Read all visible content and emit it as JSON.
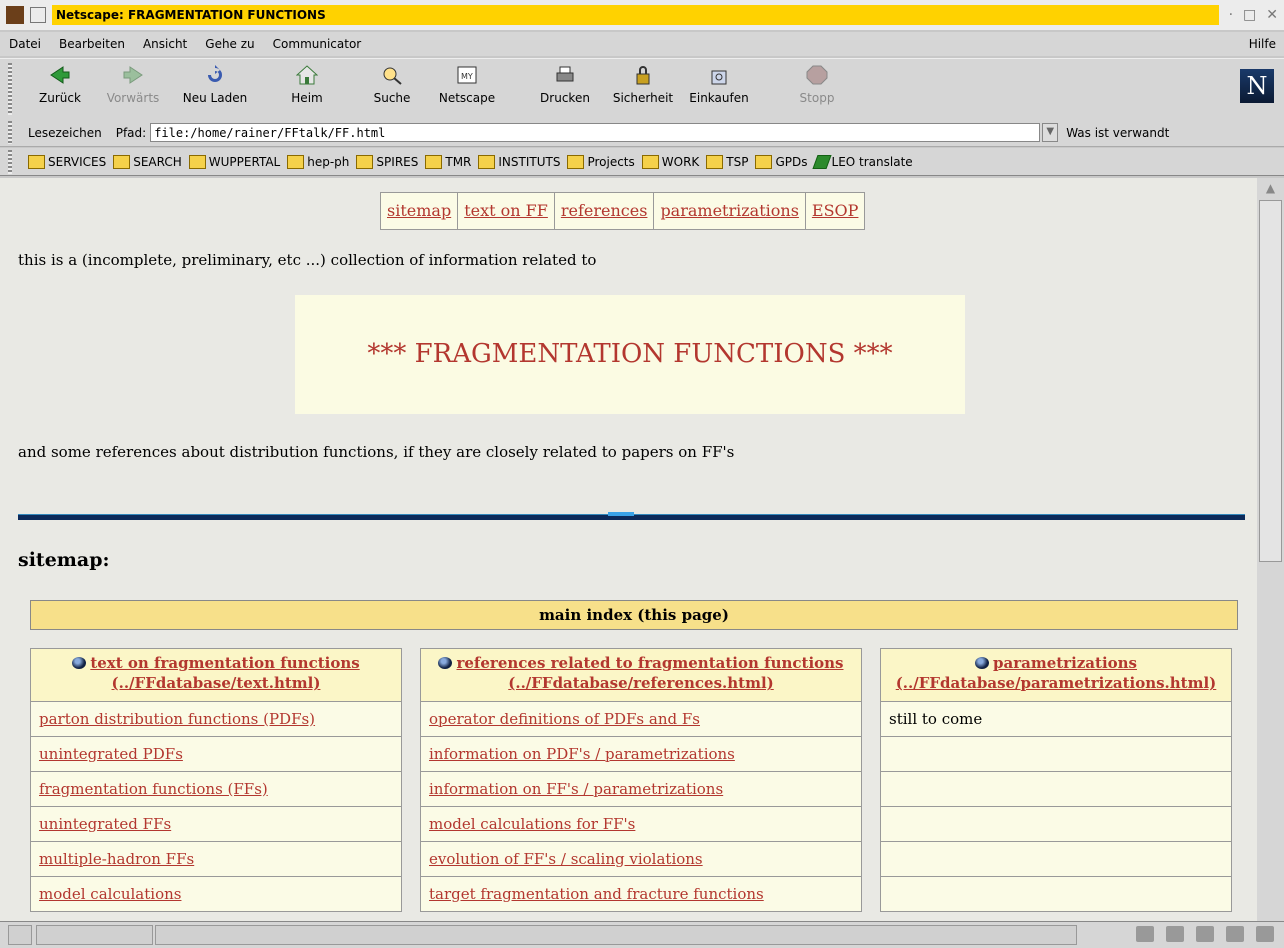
{
  "window": {
    "title": "Netscape: FRAGMENTATION FUNCTIONS",
    "controls": [
      "·",
      "□",
      "✕"
    ]
  },
  "menu": {
    "items": [
      "Datei",
      "Bearbeiten",
      "Ansicht",
      "Gehe zu",
      "Communicator"
    ],
    "help": "Hilfe"
  },
  "toolbar": {
    "back": "Zurück",
    "forward": "Vorwärts",
    "reload": "Neu Laden",
    "home": "Heim",
    "search": "Suche",
    "netscape": "Netscape",
    "print": "Drucken",
    "security": "Sicherheit",
    "shop": "Einkaufen",
    "stop": "Stopp",
    "logo": "N"
  },
  "location": {
    "bookmarks": "Lesezeichen",
    "path_label": "Pfad:",
    "url": "file:/home/rainer/FFtalk/FF.html",
    "related": "Was ist verwandt"
  },
  "bookmarks_bar": [
    "SERVICES",
    "SEARCH",
    "WUPPERTAL",
    "hep-ph",
    "SPIRES",
    "TMR",
    "INSTITUTS",
    "Projects",
    "WORK",
    "TSP",
    "GPDs",
    "LEO translate"
  ],
  "page": {
    "nav": [
      "sitemap",
      "text on FF",
      "references",
      "parametrizations",
      "ESOP"
    ],
    "intro": "this is a (incomplete, preliminary, etc ...) collection of information related to",
    "hero": "*** FRAGMENTATION FUNCTIONS ***",
    "outro": "and some references about distribution functions, if they are closely related to papers on FF's",
    "sitemap_heading": "sitemap:",
    "main_index": "main index (this page)",
    "columns": [
      {
        "title": "text on fragmentation functions",
        "path": "(../FFdatabase/text.html)",
        "rows": [
          "parton distribution functions (PDFs)",
          "unintegrated PDFs",
          "fragmentation functions (FFs)",
          "unintegrated FFs",
          "multiple-hadron FFs",
          "model calculations"
        ]
      },
      {
        "title": "references related to fragmentation functions",
        "path": "(../FFdatabase/references.html)",
        "rows": [
          "operator definitions of PDFs and Fs",
          "information on PDF's / parametrizations",
          "information on FF's / parametrizations",
          "model calculations for FF's",
          "evolution of FF's / scaling violations",
          "target fragmentation and fracture functions"
        ]
      },
      {
        "title": "parametrizations",
        "path": "(../FFdatabase/parametrizations.html)",
        "rows": [
          "still to come",
          "",
          "",
          "",
          "",
          ""
        ]
      }
    ]
  }
}
